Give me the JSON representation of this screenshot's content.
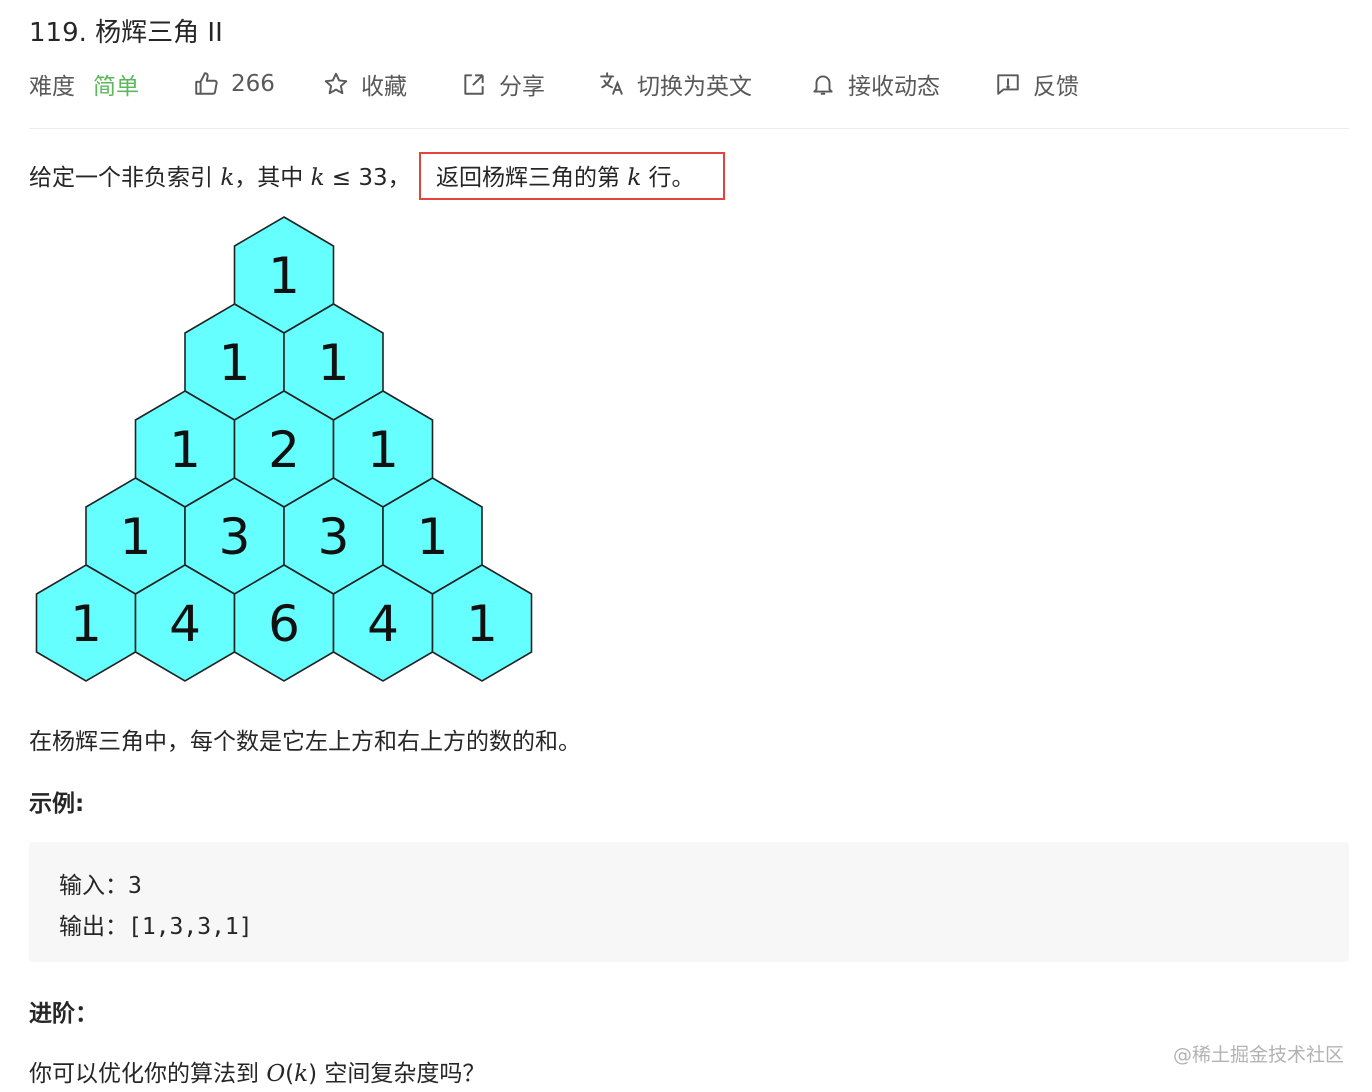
{
  "problem": {
    "title": "119. 杨辉三角 II"
  },
  "meta": {
    "difficulty_label": "难度",
    "difficulty_value": "简单",
    "likes": "266",
    "favorite": "收藏",
    "share": "分享",
    "switch_lang": "切换为英文",
    "notify": "接收动态",
    "feedback": "反馈"
  },
  "description": {
    "p1_a": "给定一个非负索引 ",
    "k": "k",
    "p1_b": "，其中 ",
    "p1_c": " ≤ 33，",
    "p1_hl_a": "返回杨辉三角的第 ",
    "p1_hl_b": " 行。",
    "p2": "在杨辉三角中，每个数是它左上方和右上方的数的和。"
  },
  "triangle": {
    "rows": [
      [
        1
      ],
      [
        1,
        1
      ],
      [
        1,
        2,
        1
      ],
      [
        1,
        3,
        3,
        1
      ],
      [
        1,
        4,
        6,
        4,
        1
      ]
    ],
    "fill_color": "#66ffff",
    "stroke_color": "#222222"
  },
  "example": {
    "heading": "示例:",
    "input_label": "输入：",
    "input_value": "3",
    "output_label": "输出：",
    "output_value": "[1,3,3,1]"
  },
  "followup": {
    "heading": "进阶：",
    "text_a": "你可以优化你的算法到 ",
    "text_o": "O",
    "text_b": "(",
    "text_k": "k",
    "text_c": ") 空间复杂度吗？"
  },
  "watermark": "@稀土掘金技术社区"
}
